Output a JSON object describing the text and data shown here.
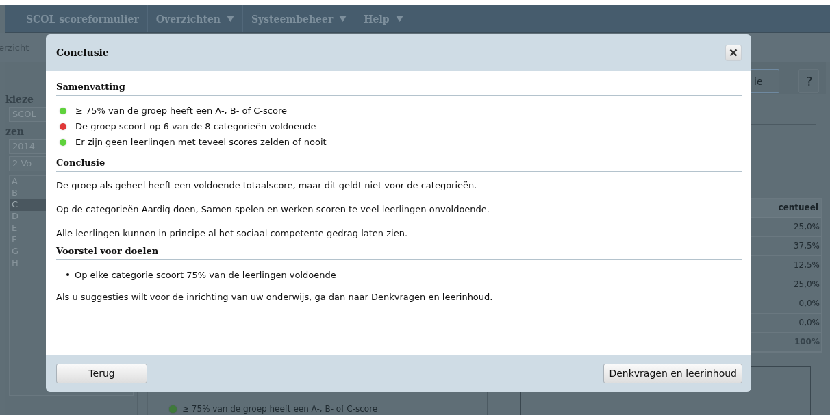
{
  "nav": {
    "items": [
      {
        "label": "SCOL scoreformulier",
        "has_menu": false
      },
      {
        "label": "Overzichten",
        "has_menu": true
      },
      {
        "label": "Systeembeheer",
        "has_menu": true
      },
      {
        "label": "Help",
        "has_menu": true
      }
    ]
  },
  "breadcrumb": "erzicht",
  "sidebar": {
    "heading_1": "kieze",
    "select_1": "SCOL",
    "heading_2": "zen",
    "select_2": "2014-",
    "select_3": "2 Vo",
    "items": [
      {
        "label": "A",
        "selected": false
      },
      {
        "label": "B",
        "selected": false
      },
      {
        "label": "C",
        "selected": true
      },
      {
        "label": "D",
        "selected": false
      },
      {
        "label": "E",
        "selected": false
      },
      {
        "label": "F",
        "selected": false
      },
      {
        "label": "G",
        "selected": false
      },
      {
        "label": "H",
        "selected": false
      }
    ]
  },
  "toolbar": {
    "button": "ie",
    "help": "?"
  },
  "table": {
    "column": "centueel",
    "rows": [
      {
        "value": "25,0%",
        "total": false
      },
      {
        "value": "37,5%",
        "total": false
      },
      {
        "value": "12,5%",
        "total": false
      },
      {
        "value": "25,0%",
        "total": false
      },
      {
        "value": "0,0%",
        "total": false
      },
      {
        "value": "0,0%",
        "total": false
      },
      {
        "value": "100%",
        "total": true
      }
    ]
  },
  "legend": {
    "text": "≥ 75% van de groep heeft een A-, B- of C-score",
    "color": "#3f7a3a"
  },
  "dialog": {
    "title": "Conclusie",
    "sections": [
      {
        "heading": "Samenvatting",
        "kind": "status_list",
        "items": [
          {
            "text": "≥ 75% van de groep heeft een A-, B- of C-score",
            "color": "#5fd23c"
          },
          {
            "text": "De groep scoort op 6 van de 8 categorieën voldoende",
            "color": "#e03838"
          },
          {
            "text": "Er zijn geen leerlingen met teveel scores zelden of nooit",
            "color": "#5fd23c"
          }
        ]
      },
      {
        "heading": "Conclusie",
        "kind": "paragraphs",
        "items": [
          {
            "text": "De groep als geheel heeft een voldoende totaalscore, maar dit geldt niet voor de categorieën."
          },
          {
            "text": "Op de categorieën Aardig doen, Samen spelen en werken scoren te veel leerlingen onvoldoende."
          },
          {
            "text": "Alle leerlingen kunnen in principe al het sociaal competente gedrag laten zien."
          }
        ]
      },
      {
        "heading": "Voorstel voor doelen",
        "kind": "bullets",
        "items": [
          {
            "text": "Op elke categorie scoort 75% van de leerlingen voldoende"
          }
        ]
      }
    ],
    "note": "Als u suggesties wilt voor de inrichting van uw onderwijs, ga dan naar Denkvragen en leerinhoud.",
    "buttons": [
      {
        "label": "Terug",
        "kind": "back"
      },
      {
        "label": "Denkvragen en leerinhoud",
        "kind": "forward"
      }
    ]
  }
}
